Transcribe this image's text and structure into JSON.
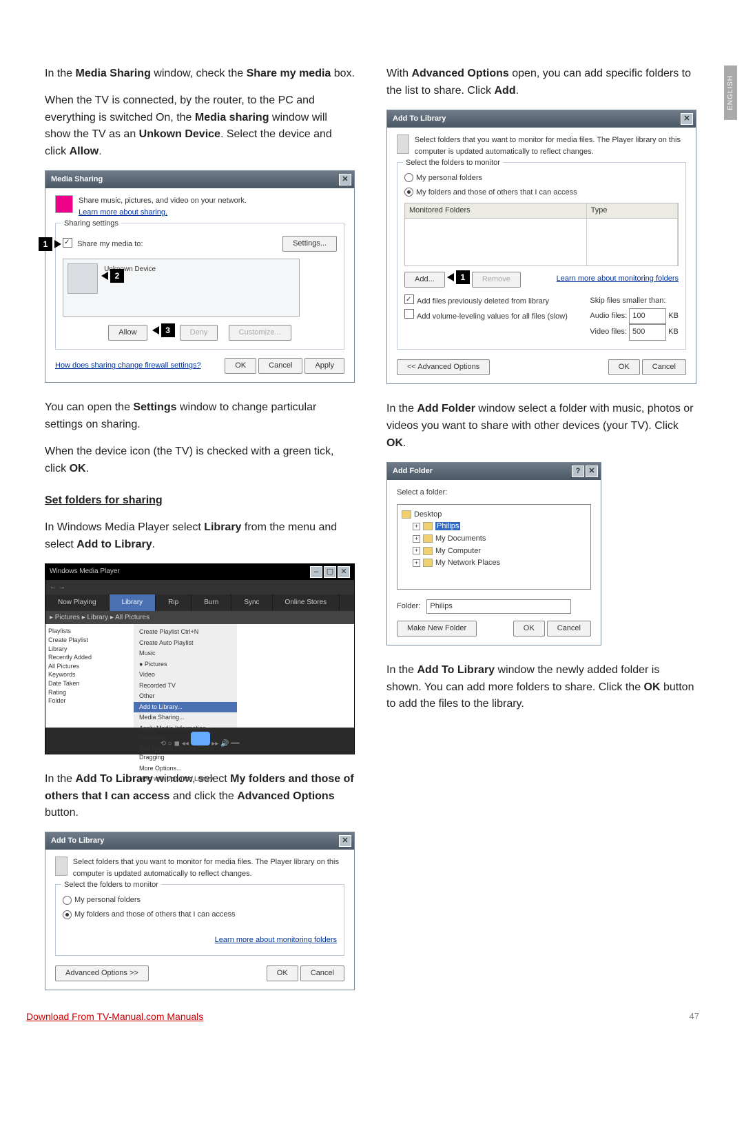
{
  "side_tab": "ENGLISH",
  "page_number": "47",
  "footer_link": "Download From TV-Manual.com Manuals",
  "left": {
    "p1_a": "In the ",
    "p1_b": "Media Sharing",
    "p1_c": " window, check the ",
    "p1_d": "Share my media",
    "p1_e": " box.",
    "p2_a": "When the TV is connected, by the router, to the PC and everything is switched On, the ",
    "p2_b": "Media sharing",
    "p2_c": " window will show the TV as an ",
    "p2_d": "Unkown Device",
    "p2_e": ". Select the device and click ",
    "p2_f": "Allow",
    "p2_g": ".",
    "p3_a": "You can open the ",
    "p3_b": "Settings",
    "p3_c": " window to change particular settings on sharing.",
    "p4_a": "When the device icon (the TV) is checked with a green tick, click ",
    "p4_b": "OK",
    "p4_c": ".",
    "heading1": "Set folders for sharing",
    "p5_a": "In Windows Media Player select ",
    "p5_b": "Library",
    "p5_c": " from the menu and select ",
    "p5_d": "Add to Library",
    "p5_e": ".",
    "p6_a": "In the ",
    "p6_b": "Add To Library",
    "p6_c": " window, select ",
    "p6_d": "My folders and those of others that I can access",
    "p6_e": " and click the ",
    "p6_f": "Advanced Options",
    "p6_g": " button."
  },
  "right": {
    "p1_a": "With ",
    "p1_b": "Advanced Options",
    "p1_c": " open, you can add specific folders to the list to share. Click ",
    "p1_d": "Add",
    "p1_e": ".",
    "p2_a": "In the ",
    "p2_b": "Add Folder",
    "p2_c": " window select a folder with music, photos or videos you want to share with other devices (your TV). Click ",
    "p2_d": "OK",
    "p2_e": ".",
    "p3_a": "In the ",
    "p3_b": "Add To Library",
    "p3_c": " window the newly added folder is shown. You can add more folders to share. Click the ",
    "p3_d": "OK",
    "p3_e": " button to add the files to the library."
  },
  "media_sharing": {
    "title": "Media Sharing",
    "desc": "Share music, pictures, and video on your network.",
    "learn": "Learn more about sharing.",
    "legend": "Sharing settings",
    "share": "Share my media to:",
    "settings": "Settings...",
    "device": "Unknown Device",
    "allow": "Allow",
    "deny": "Deny",
    "customize": "Customize...",
    "firewall": "How does sharing change firewall settings?",
    "ok": "OK",
    "cancel": "Cancel",
    "apply": "Apply"
  },
  "wmp": {
    "title": "Windows Media Player",
    "tabs": [
      "Now Playing",
      "Library",
      "Rip",
      "Burn",
      "Sync",
      "Online Stores"
    ],
    "crumbs": "▸ Pictures ▸ Library ▸ All Pictures",
    "side": [
      "Playlists",
      "  Create Playlist",
      "Library",
      "  Recently Added",
      "  All Pictures",
      "  Keywords",
      "  Date Taken",
      "  Rating",
      "  Folder"
    ],
    "menu": [
      "Create Playlist        Ctrl+N",
      "Create Auto Playlist",
      "Music",
      "● Pictures",
      "Video",
      "Recorded TV",
      "Other",
      "Add to Library...",
      "Media Sharing...",
      "Apply Media Information Changes",
      "Add Favorites to List When Dragging",
      "More Options...",
      "Help with Using the Library"
    ],
    "highlight_index": 7
  },
  "atl": {
    "title": "Add To Library",
    "desc": "Select folders that you want to monitor for media files. The Player library on this computer is updated automatically to reflect changes.",
    "legend": "Select the folders to monitor",
    "r1": "My personal folders",
    "r2": "My folders and those of others that I can access",
    "learn": "Learn more about monitoring folders",
    "adv": "Advanced Options >>",
    "adv_back": "<< Advanced Options",
    "ok": "OK",
    "cancel": "Cancel",
    "col1": "Monitored Folders",
    "col2": "Type",
    "add": "Add...",
    "remove": "Remove",
    "cb1": "Add files previously deleted from library",
    "cb2": "Add volume-leveling values for all files (slow)",
    "skip": "Skip files smaller than:",
    "audio": "Audio files:",
    "audio_v": "100",
    "kb": "KB",
    "video": "Video files:",
    "video_v": "500"
  },
  "addfolder": {
    "title": "Add Folder",
    "select": "Select a folder:",
    "items": [
      "Desktop",
      "Philips",
      "My Documents",
      "My Computer",
      "My Network Places"
    ],
    "folder_label": "Folder:",
    "folder_value": "Philips",
    "make": "Make New Folder",
    "ok": "OK",
    "cancel": "Cancel"
  }
}
